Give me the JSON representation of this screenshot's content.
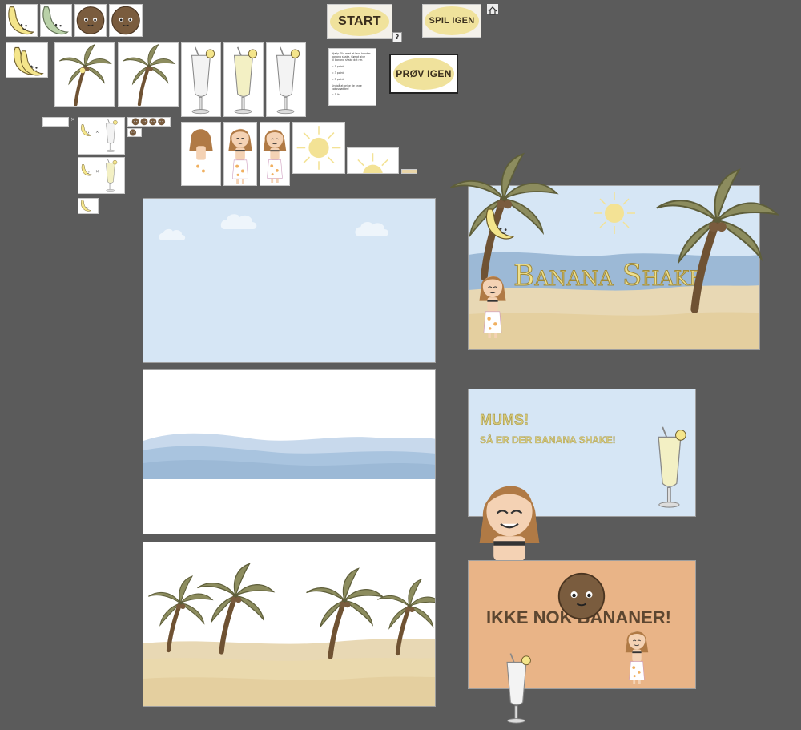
{
  "buttons": {
    "start": "START",
    "play_again": "SPIL IGEN",
    "try_again": "PRØV IGEN",
    "help": "?"
  },
  "instructions": {
    "line1": "Hjælp Ella med at lave hendes",
    "line2": "banana shake. Gør at give",
    "line3": "til banana shake det rør.",
    "rule1": "= 1 point",
    "rule2": "= 3 point",
    "rule3": "= 5 point",
    "note": "Undgå at gribe de onde kokosnødder!",
    "rule4": "= 1 liv"
  },
  "title_screen": {
    "title": "Banana Shake"
  },
  "win_screen": {
    "line1": "MUMS!",
    "line2": "SÅ ER DER BANANA SHAKE!"
  },
  "lose_screen": {
    "line1": "IKKE NOK BANANER!"
  },
  "colors": {
    "workspace": "#5b5b5b",
    "sky": "#d6e6f5",
    "sea": "#9cb9d6",
    "sand": "#e9d5a8",
    "palm_leaf": "#8c8c5e",
    "trunk": "#6f5233",
    "banana": "#f4e58b",
    "title_yellow": "#efe08d",
    "lose_bg": "#e9b487",
    "lose_text": "#5c4630",
    "sun": "#f3e295"
  },
  "icons": [
    "banana-icon",
    "green-banana-icon",
    "coconut-icon",
    "palm-tree-icon",
    "milkshake-glass-icon",
    "girl-character-icon",
    "sun-icon",
    "home-icon",
    "help-icon",
    "cloud-icon"
  ]
}
